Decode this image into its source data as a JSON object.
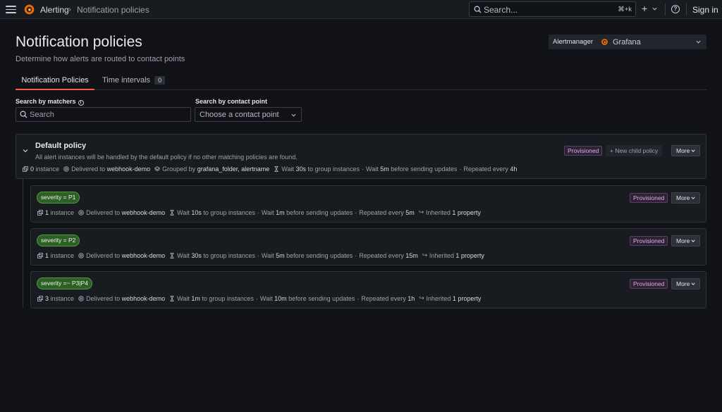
{
  "topbar": {
    "breadcrumb": [
      "Alerting",
      "Notification policies"
    ],
    "breadcrumb_sep": "›",
    "search_placeholder": "Search...",
    "search_shortcut": "⌘+k",
    "plus": "+",
    "help": "?",
    "sign_in": "Sign in"
  },
  "header": {
    "title": "Notification policies",
    "subtitle": "Determine how alerts are routed to contact points",
    "alertmanager_label": "Alertmanager",
    "alertmanager_value": "Grafana"
  },
  "tabs": [
    {
      "label": "Notification Policies",
      "active": true
    },
    {
      "label": "Time intervals",
      "count": "0"
    }
  ],
  "filters": {
    "matchers_label": "Search by matchers",
    "matchers_info": "i",
    "matchers_placeholder": "Search",
    "contact_label": "Search by contact point",
    "contact_placeholder": "Choose a contact point"
  },
  "default_policy": {
    "title": "Default policy",
    "description": "All alert instances will be handled by the default policy if no other matching policies are found.",
    "badge": "Provisioned",
    "new_child": "New child policy",
    "more": "More",
    "instances_count": "0",
    "instances_label": "instance",
    "delivered_label": "Delivered to",
    "contact_point": "webhook-demo",
    "grouped_label": "Grouped by",
    "grouped_by": "grafana_folder, alertname",
    "wait_label": "Wait",
    "group_wait": "30s",
    "group_wait_suffix": "to group instances",
    "group_interval": "5m",
    "group_interval_suffix": "before sending updates",
    "repeat_label": "Repeated every",
    "repeat": "4h"
  },
  "policies": [
    {
      "matcher": "severity = P1",
      "badge": "Provisioned",
      "more": "More",
      "instances_count": "1",
      "instances_label": "instance",
      "delivered_label": "Delivered to",
      "contact_point": "webhook-demo",
      "wait_label": "Wait",
      "group_wait": "10s",
      "group_wait_suffix": "to group instances",
      "group_interval": "1m",
      "group_interval_suffix": "before sending updates",
      "repeat_label": "Repeated every",
      "repeat": "5m",
      "inherited_label": "Inherited",
      "inherited": "1 property"
    },
    {
      "matcher": "severity = P2",
      "badge": "Provisioned",
      "more": "More",
      "instances_count": "1",
      "instances_label": "instance",
      "delivered_label": "Delivered to",
      "contact_point": "webhook-demo",
      "wait_label": "Wait",
      "group_wait": "30s",
      "group_wait_suffix": "to group instances",
      "group_interval": "5m",
      "group_interval_suffix": "before sending updates",
      "repeat_label": "Repeated every",
      "repeat": "15m",
      "inherited_label": "Inherited",
      "inherited": "1 property"
    },
    {
      "matcher": "severity =~ P3|P4",
      "badge": "Provisioned",
      "more": "More",
      "instances_count": "3",
      "instances_label": "instance",
      "delivered_label": "Delivered to",
      "contact_point": "webhook-demo",
      "wait_label": "Wait",
      "group_wait": "1m",
      "group_wait_suffix": "to group instances",
      "group_interval": "10m",
      "group_interval_suffix": "before sending updates",
      "repeat_label": "Repeated every",
      "repeat": "1h",
      "inherited_label": "Inherited",
      "inherited": "1 property"
    }
  ],
  "colors": {
    "background": "#111217",
    "accent": "#f55f3e",
    "matcher_green": "#2e5f26",
    "provisioned": "#d4b1e0"
  }
}
